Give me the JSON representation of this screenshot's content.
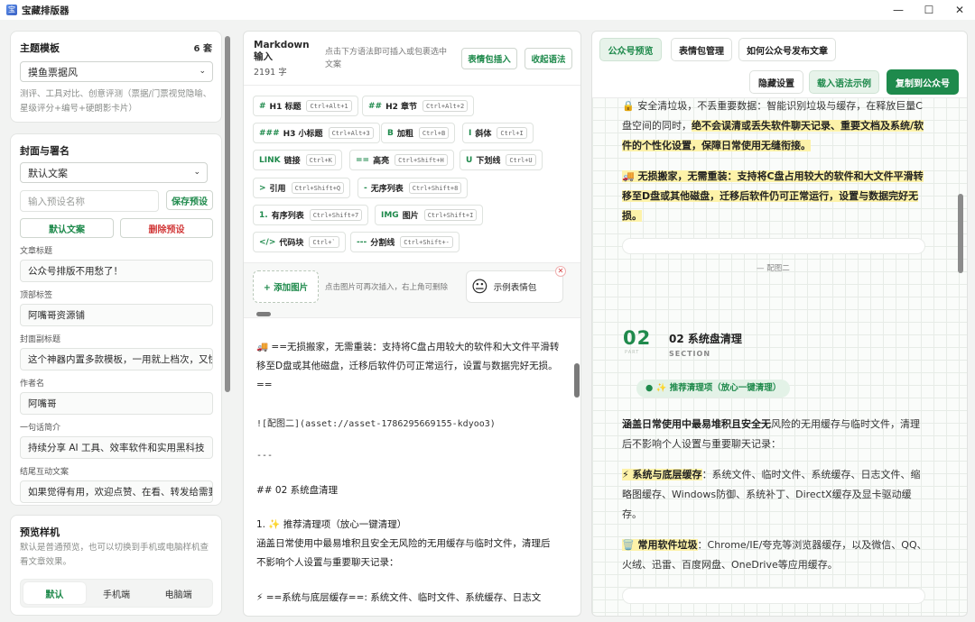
{
  "window": {
    "title": "宝藏排版器",
    "minimize": "—",
    "maximize": "☐",
    "close": "✕"
  },
  "theme": {
    "title": "主题模板",
    "count": "6 套",
    "selected": "摸鱼票据风",
    "desc": "测评、工具对比、创意评测（票据/门票视觉隐喻、星级评分+编号+硬朗影卡片）"
  },
  "cover": {
    "title": "封面与署名",
    "preset_selected": "默认文案",
    "preset_placeholder": "输入预设名称",
    "save_preset": "保存预设",
    "default_copy": "默认文案",
    "delete_preset": "删除预设",
    "fields": [
      {
        "label": "文章标题",
        "value": "公众号排版不用愁了！"
      },
      {
        "label": "顶部标签",
        "value": "阿嘴哥资源铺"
      },
      {
        "label": "封面副标题",
        "value": "这个神器内置多款模板，一用就上档次，又快"
      },
      {
        "label": "作者名",
        "value": "阿嘴哥"
      },
      {
        "label": "一句话简介",
        "value": "持续分享 AI 工具、效率软件和实用黑科技"
      },
      {
        "label": "结尾互动文案",
        "value": "如果觉得有用，欢迎点赞、在看、转发给需要"
      }
    ]
  },
  "preview_style": {
    "title": "预览样机",
    "desc": "默认是普通预览，也可以切换到手机或电脑样机查看文章效果。",
    "options": [
      "默认",
      "手机端",
      "电脑端"
    ]
  },
  "markdown": {
    "title": "Markdown 输入",
    "count": "2191 字",
    "hint": "点击下方语法即可插入或包裹选中文案",
    "emoji_insert": "表情包插入",
    "collapse": "收起语法",
    "syntax": [
      {
        "mark": "#",
        "label": "H1 标题",
        "key": "Ctrl+Alt+1"
      },
      {
        "mark": "##",
        "label": "H2 章节",
        "key": "Ctrl+Alt+2"
      },
      {
        "mark": "###",
        "label": "H3 小标题",
        "key": "Ctrl+Alt+3"
      },
      {
        "mark": "B",
        "label": "加粗",
        "key": "Ctrl+B"
      },
      {
        "mark": "I",
        "label": "斜体",
        "key": "Ctrl+I"
      },
      {
        "mark": "LINK",
        "label": "链接",
        "key": "Ctrl+K"
      },
      {
        "mark": "==",
        "label": "高亮",
        "key": "Ctrl+Shift+H"
      },
      {
        "mark": "U",
        "label": "下划线",
        "key": "Ctrl+U"
      },
      {
        "mark": ">",
        "label": "引用",
        "key": "Ctrl+Shift+Q"
      },
      {
        "mark": "-",
        "label": "无序列表",
        "key": "Ctrl+Shift+8"
      },
      {
        "mark": "1.",
        "label": "有序列表",
        "key": "Ctrl+Shift+7"
      },
      {
        "mark": "IMG",
        "label": "图片",
        "key": "Ctrl+Shift+I"
      },
      {
        "mark": "</>",
        "label": "代码块",
        "key": "Ctrl+`"
      },
      {
        "mark": "---",
        "label": "分割线",
        "key": "Ctrl+Shift+-"
      }
    ],
    "add_image": "+ 添加图片",
    "image_hint": "点击图片可再次插入，右上角可删除",
    "sample_emoji": "示例表情包",
    "editor_lines": {
      "l1": "🚚 ==无损搬家，无需重装：支持将C盘占用较大的软件和大文件平滑转",
      "l2": "移至D盘或其他磁盘，迁移后软件仍可正常运行，设置与数据完好无损。",
      "l3": "==",
      "l4": "![配图二](asset://asset-1786295669155-kdyoo3)",
      "l5": "---",
      "l6": "## 02 系统盘清理",
      "l7": "1. ✨ 推荐清理项（放心一键清理）",
      "l8": "涵盖日常使用中最易堆积且安全无风险的无用缓存与临时文件，清理后",
      "l9": "不影响个人设置与重要聊天记录：",
      "l10": "⚡ ==系统与底层缓存==: 系统文件、临时文件、系统缓存、日志文"
    }
  },
  "preview": {
    "tabs": [
      "公众号预览",
      "表情包管理",
      "如何公众号发布文章"
    ],
    "hide_settings": "隐藏设置",
    "load_example": "载入语法示例",
    "copy": "复制到公众号",
    "p1_a": "🔒 安全清垃圾，不丢重要数据：智能识别垃圾与缓存，在释放巨量C盘空间的同时，",
    "p1_hl": "绝不会误清或丢失软件聊天记录、重要文档及系统/软件的个性化设置，保障日常使用无缝衔接。",
    "p2_hl": "🚚 无损搬家，无需重装：支持将C盘占用较大的软件和大文件平滑转移至D盘或其他磁盘，迁移后软件仍可正常运行，设置与数据完好无损。",
    "caption": "— 配图二",
    "section_num": "02",
    "section_part": "PART",
    "section_title": "02 系统盘清理",
    "section_sub": "SECTION",
    "badge": "● ✨ 推荐清理项（放心一键清理）",
    "p3_b": "涵盖日常使用中最易堆积且安全无",
    "p3_r": "风险的无用缓存与临时文件，清理后不影响个人设置与重要聊天记录：",
    "p4_hl": "⚡ 系统与底层缓存",
    "p4_r": "：系统文件、临时文件、系统缓存、日志文件、缩略图缓存、Windows防御、系统补丁、DirectX缓存及显卡驱动缓存。",
    "p5_hl": "🗑️ 常用软件垃圾",
    "p5_r": "：Chrome/IE/夸克等浏览器缓存，以及微信、QQ、火绒、迅雷、百度网盘、OneDrive等应用缓存。"
  }
}
